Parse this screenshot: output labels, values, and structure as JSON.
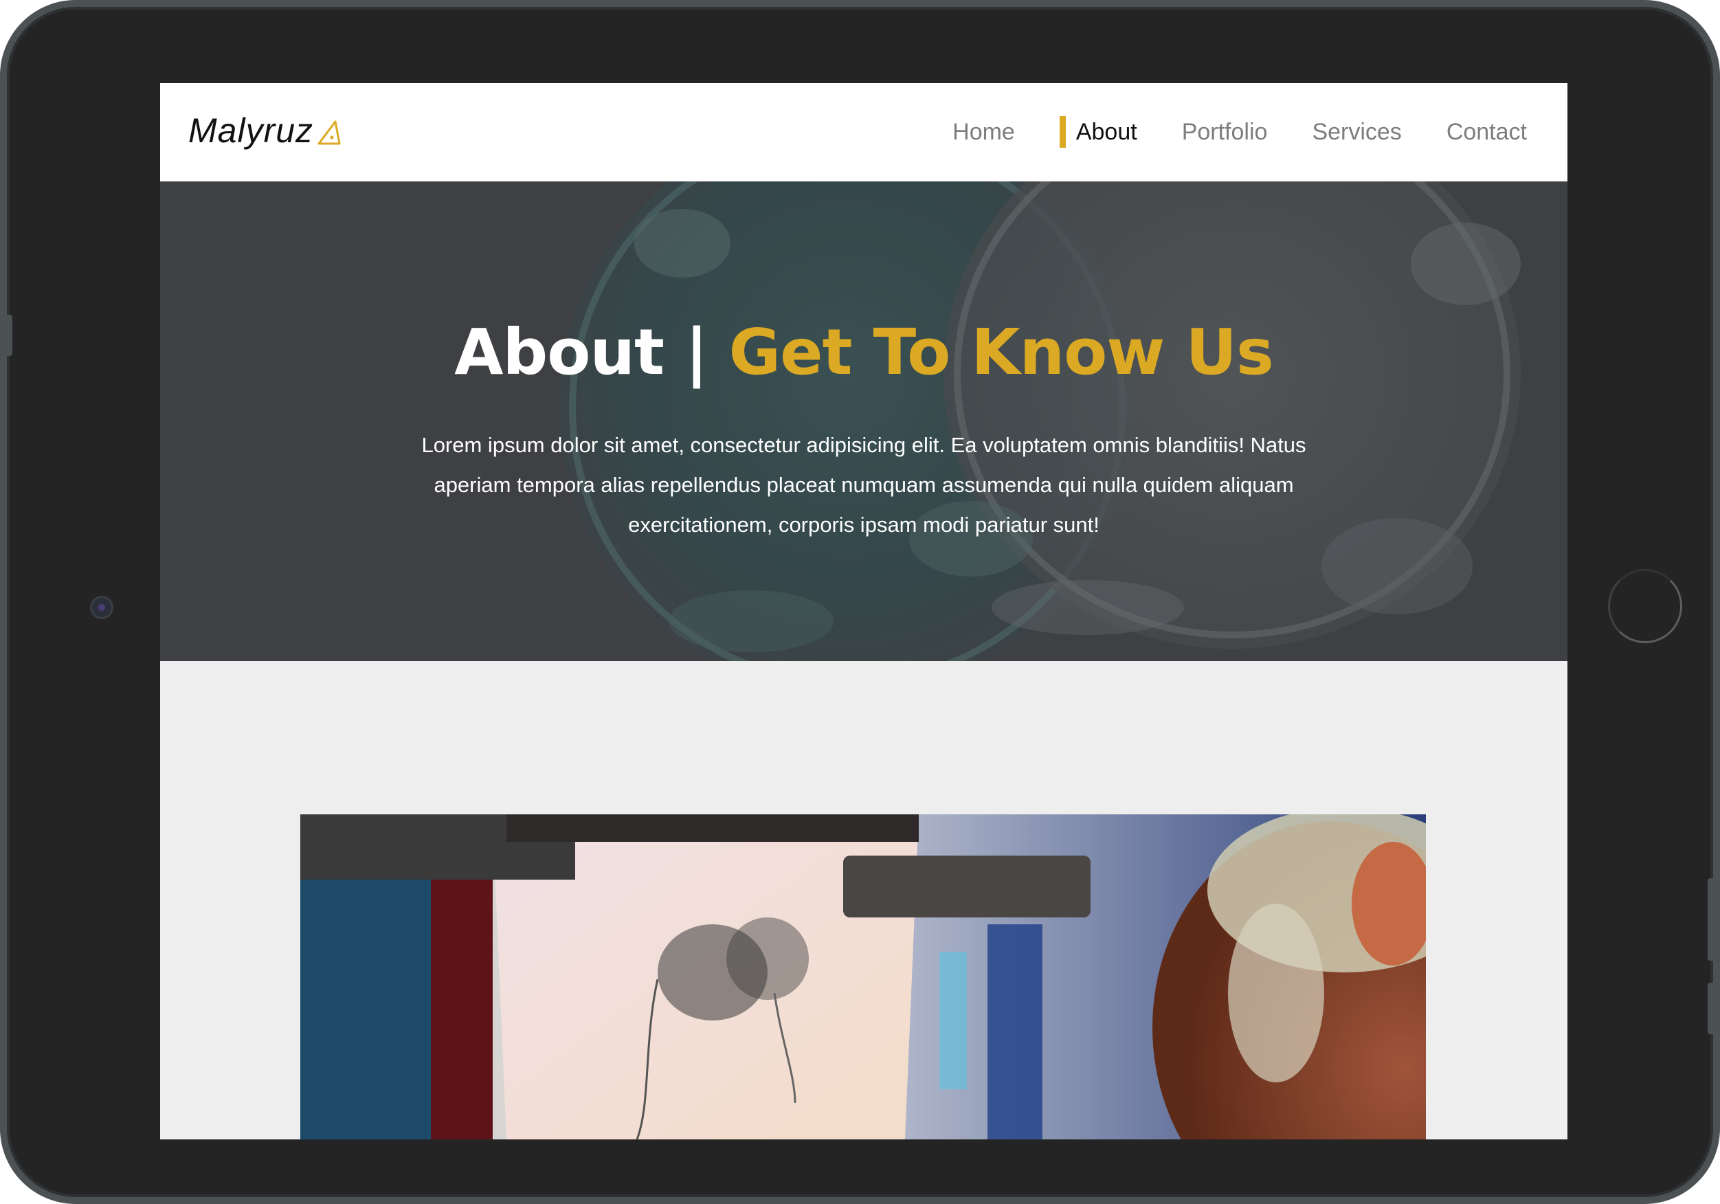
{
  "nav": {
    "logo_text": "Malyruz",
    "logo_icon": "triangle-logo-icon",
    "links": [
      {
        "label": "Home",
        "active": false
      },
      {
        "label": "About",
        "active": true
      },
      {
        "label": "Portfolio",
        "active": false
      },
      {
        "label": "Services",
        "active": false
      },
      {
        "label": "Contact",
        "active": false
      }
    ]
  },
  "hero": {
    "title_main": "About",
    "title_separator": "|",
    "title_accent": "Get To Know Us",
    "text": "Lorem ipsum dolor sit amet, consectetur adipisicing elit. Ea voluptatem omnis blanditiis! Natus aperiam tempora alias repellendus placeat numquam assumenda qui nulla quidem aliquam exercitationem, corporis ipsam modi pariatur sunt!"
  },
  "colors": {
    "accent": "#dba923",
    "nav_background": "#ffffff",
    "section_background": "#eeeeee",
    "frame": "#242424"
  }
}
